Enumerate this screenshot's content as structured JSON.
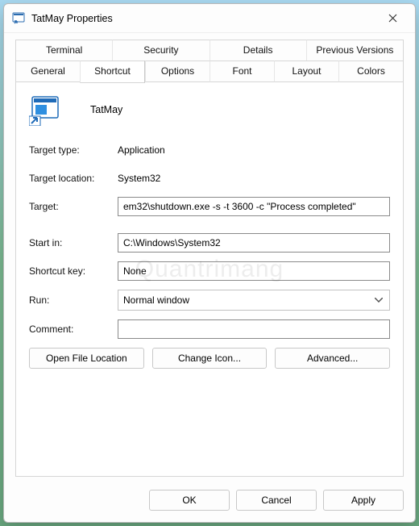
{
  "window": {
    "title": "TatMay Properties"
  },
  "tabs": {
    "row1": [
      {
        "label": "Terminal"
      },
      {
        "label": "Security"
      },
      {
        "label": "Details"
      },
      {
        "label": "Previous Versions"
      }
    ],
    "row2": [
      {
        "label": "General"
      },
      {
        "label": "Shortcut",
        "active": true
      },
      {
        "label": "Options"
      },
      {
        "label": "Font"
      },
      {
        "label": "Layout"
      },
      {
        "label": "Colors"
      }
    ]
  },
  "header": {
    "name": "TatMay"
  },
  "fields": {
    "target_type_label": "Target type:",
    "target_type_value": "Application",
    "target_location_label": "Target location:",
    "target_location_value": "System32",
    "target_label": "Target:",
    "target_value": "em32\\shutdown.exe -s -t 3600 -c \"Process completed\"",
    "start_in_label": "Start in:",
    "start_in_value": "C:\\Windows\\System32",
    "shortcut_key_label": "Shortcut key:",
    "shortcut_key_value": "None",
    "run_label": "Run:",
    "run_value": "Normal window",
    "comment_label": "Comment:",
    "comment_value": ""
  },
  "panel_buttons": {
    "open_file_location": "Open File Location",
    "change_icon": "Change Icon...",
    "advanced": "Advanced..."
  },
  "footer": {
    "ok": "OK",
    "cancel": "Cancel",
    "apply": "Apply"
  },
  "watermark": "Quantrimang"
}
